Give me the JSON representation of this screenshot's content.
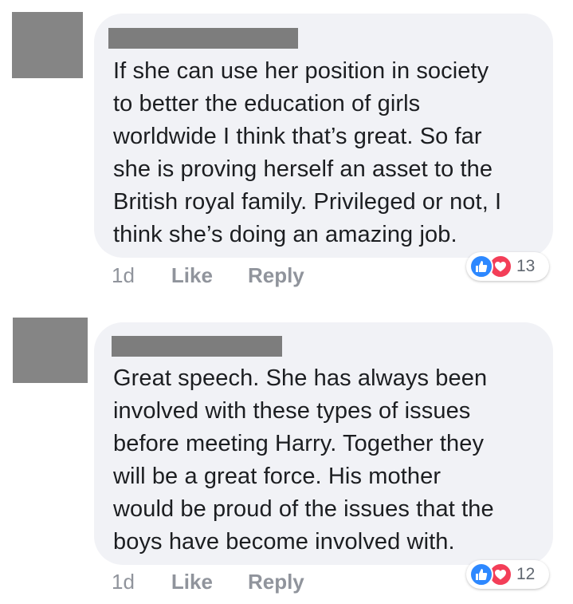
{
  "comments": [
    {
      "text": "If she can use her position in society\nto better the education of girls\nworldwide I think that’s great. So far\nshe is proving herself an asset to the\nBritish royal family. Privileged or not, I\nthink she’s doing an amazing job.",
      "age": "1d",
      "like_label": "Like",
      "reply_label": "Reply",
      "reaction_count": "13"
    },
    {
      "text": "Great speech. She has always been\ninvolved with these types of issues\nbefore meeting Harry. Together they\nwill be a great force. His mother\nwould be proud of the issues that the\nboys have become involved with.",
      "age": "1d",
      "like_label": "Like",
      "reply_label": "Reply",
      "reaction_count": "12"
    }
  ],
  "reactions": [
    {
      "name": "like",
      "icon": "thumbs-up-icon",
      "color": "#2d88ff"
    },
    {
      "name": "love",
      "icon": "heart-icon",
      "color": "#f33e58"
    }
  ],
  "colors": {
    "bubble": "#f1f2f6",
    "text": "#1c1e21",
    "meta": "#90949c",
    "redaction": "#7d7d7d"
  }
}
